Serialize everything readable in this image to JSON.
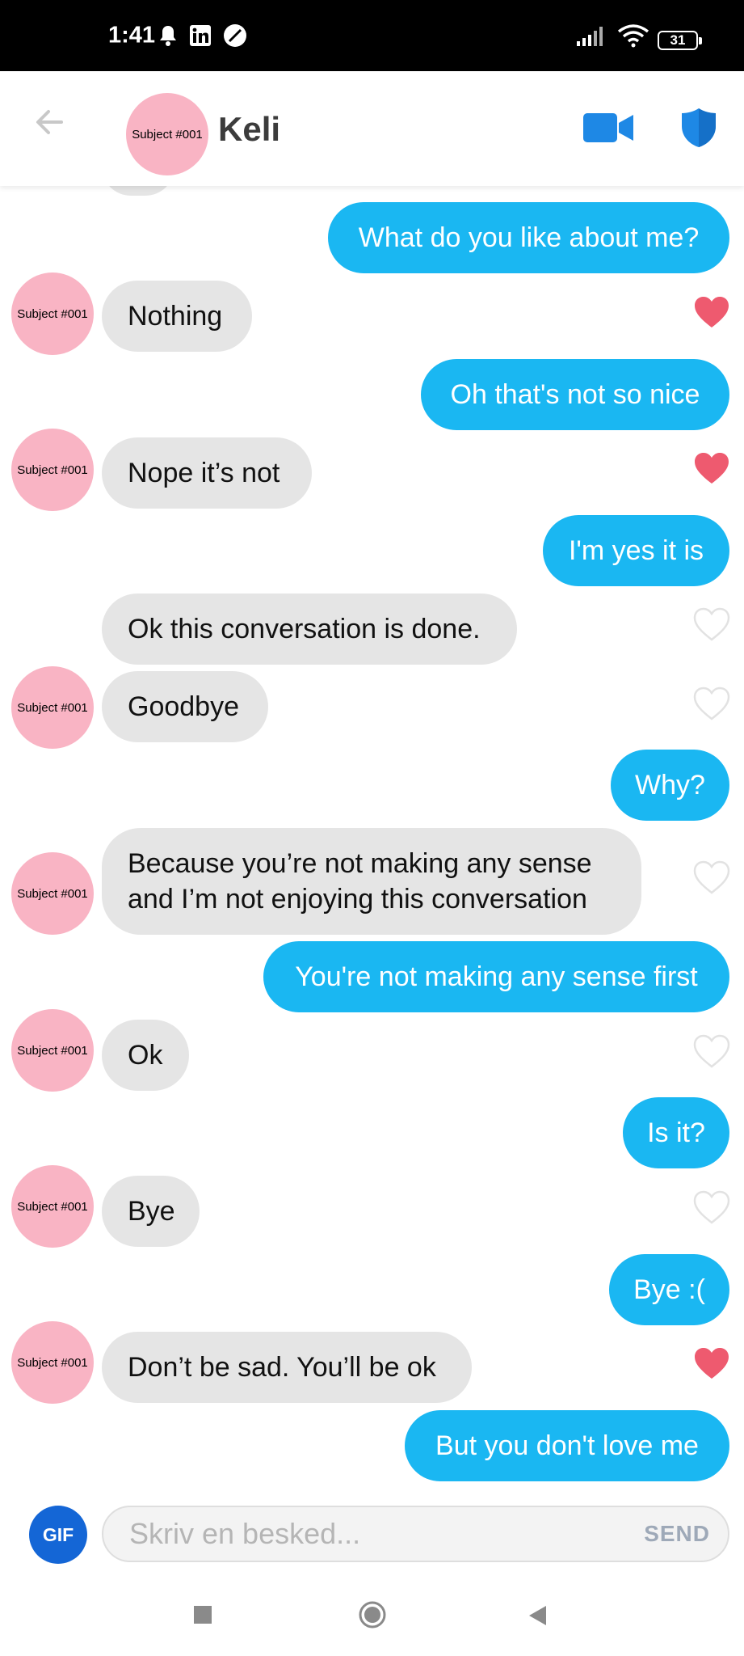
{
  "status_bar": {
    "time": "1:41",
    "battery": "31",
    "icons": [
      "bell-icon",
      "linkedin-icon",
      "app-icon",
      "signal-icon",
      "wifi-icon",
      "battery-icon"
    ]
  },
  "header": {
    "avatar_label": "Subject #001",
    "name": "Keli",
    "icons": [
      "back-arrow-icon",
      "video-camera-icon",
      "shield-icon"
    ]
  },
  "conversation": {
    "messages": [
      {
        "from": "me",
        "text": "What do you like about me?"
      },
      {
        "from": "them",
        "text": "Nothing",
        "avatar_label": "Subject #001",
        "liked": true
      },
      {
        "from": "me",
        "text": "Oh that's not so nice"
      },
      {
        "from": "them",
        "text": "Nope it’s not",
        "avatar_label": "Subject #001",
        "liked": true
      },
      {
        "from": "me",
        "text": "I'm yes it is"
      },
      {
        "from": "them",
        "text": "Ok this conversation is done.",
        "liked": false
      },
      {
        "from": "them",
        "text": "Goodbye",
        "avatar_label": "Subject #001",
        "liked": false
      },
      {
        "from": "me",
        "text": "Why?"
      },
      {
        "from": "them",
        "lines": [
          "Because you’re not making any sense",
          "and I’m not enjoying this conversation"
        ],
        "avatar_label": "Subject #001",
        "liked": false
      },
      {
        "from": "me",
        "text": "You're not making any sense first"
      },
      {
        "from": "them",
        "text": "Ok",
        "avatar_label": "Subject #001",
        "liked": false
      },
      {
        "from": "me",
        "text": "Is it?"
      },
      {
        "from": "them",
        "text": "Bye",
        "avatar_label": "Subject #001",
        "liked": false
      },
      {
        "from": "me",
        "text": "Bye :("
      },
      {
        "from": "them",
        "text": "Don’t be sad. You’ll be ok",
        "avatar_label": "Subject #001",
        "liked": true
      },
      {
        "from": "me",
        "text": "But you don't love me"
      }
    ]
  },
  "composer": {
    "gif_label": "GIF",
    "placeholder": "Skriv en besked...",
    "send_label": "SEND"
  },
  "colors": {
    "sent_bubble": "#1ab7f2",
    "received_bubble": "#e5e5e5",
    "heart_liked": "#ee5a6f",
    "accent_blue": "#1e88e5",
    "gif_button": "#1466d6"
  }
}
